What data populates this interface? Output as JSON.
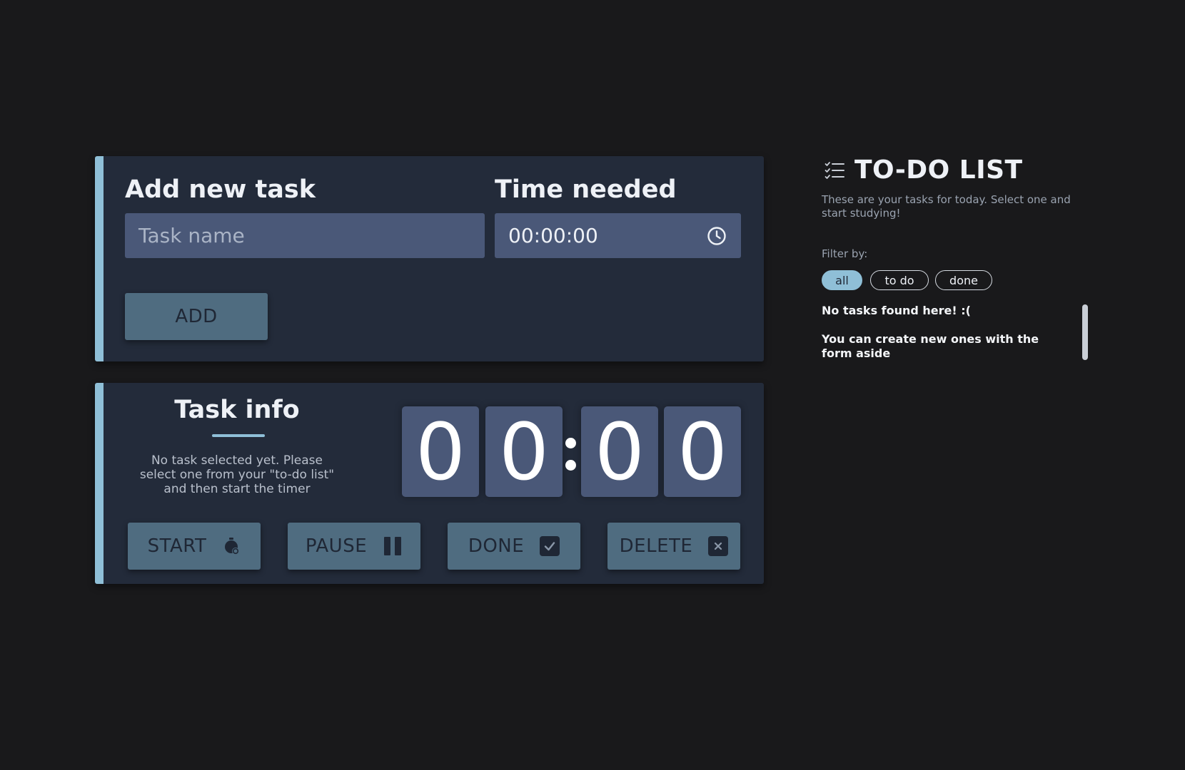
{
  "add_task": {
    "task_label": "Add new task",
    "task_placeholder": "Task name",
    "time_label": "Time needed",
    "time_value": "00:00:00",
    "add_button": "ADD"
  },
  "task_info": {
    "title": "Task info",
    "message": "No task selected yet. Please select one from your \"to-do list\" and then start the timer",
    "timer_digits": [
      "0",
      "0",
      "0",
      "0"
    ],
    "buttons": {
      "start": "START",
      "pause": "PAUSE",
      "done": "DONE",
      "delete": "DELETE"
    }
  },
  "todo": {
    "title": "TO-DO LIST",
    "subtitle": "These are your tasks for today. Select one and start studying!",
    "filter_label": "Filter by:",
    "filters": [
      "all",
      "to do",
      "done"
    ],
    "active_filter": "all",
    "empty_title": "No tasks found here! :(",
    "empty_text": "You can create new ones with the form aside"
  },
  "colors": {
    "background": "#19191b",
    "panel": "#232b3a",
    "accent": "#8fbfd7",
    "field": "#4a5878",
    "button": "#4f6c80"
  },
  "icons": {
    "todo_header": "checklist-icon",
    "time_field": "clock-icon",
    "start": "stopwatch-icon",
    "pause": "pause-icon",
    "done": "check-square-icon",
    "delete": "x-square-icon"
  }
}
